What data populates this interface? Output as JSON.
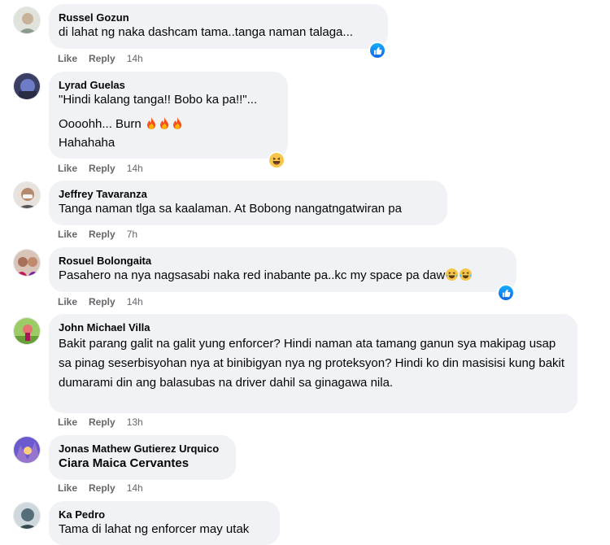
{
  "actions": {
    "like": "Like",
    "reply": "Reply"
  },
  "colors": {
    "bubble": "#f0f2f5",
    "meta": "#65676b",
    "like_blue": "#0d66e8"
  },
  "comments": [
    {
      "name": "Russel Gozun",
      "text": "di lahat ng naka dashcam tama..tanga naman talaga...",
      "time": "14h",
      "reaction": "like-icon"
    },
    {
      "name": "Lyrad Guelas",
      "line1": "\"Hindi kalang tanga!! Bobo ka pa!!\"...",
      "line2": "Oooohh... Burn",
      "line3": "Hahahaha",
      "time": "14h",
      "reaction": "haha-icon"
    },
    {
      "name": "Jeffrey Tavaranza",
      "text": "Tanga naman tlga sa kaalaman. At Bobong nangatngatwiran pa",
      "time": "7h"
    },
    {
      "name": "Rosuel Bolongaita",
      "text": "Pasahero na nya nagsasabi naka red inabante pa..kc my space pa daw",
      "time": "14h",
      "reaction": "like-icon"
    },
    {
      "name": "John Michael Villa",
      "text": "Bakit parang galit na galit yung enforcer? Hindi naman ata tamang ganun sya makipag usap sa pinag seserbisyohan nya at binibigyan nya ng proteksyon? Hindi ko din masisisi kung bakit dumarami din ang balasubas na driver dahil sa ginagawa nila.",
      "time": "13h"
    },
    {
      "name": "Jonas Mathew Gutierez Urquico",
      "tag": "Ciara Maica Cervantes",
      "time": "14h"
    },
    {
      "name": "Ka Pedro",
      "text": "Tama di lahat ng enforcer may utak",
      "time": ""
    }
  ]
}
